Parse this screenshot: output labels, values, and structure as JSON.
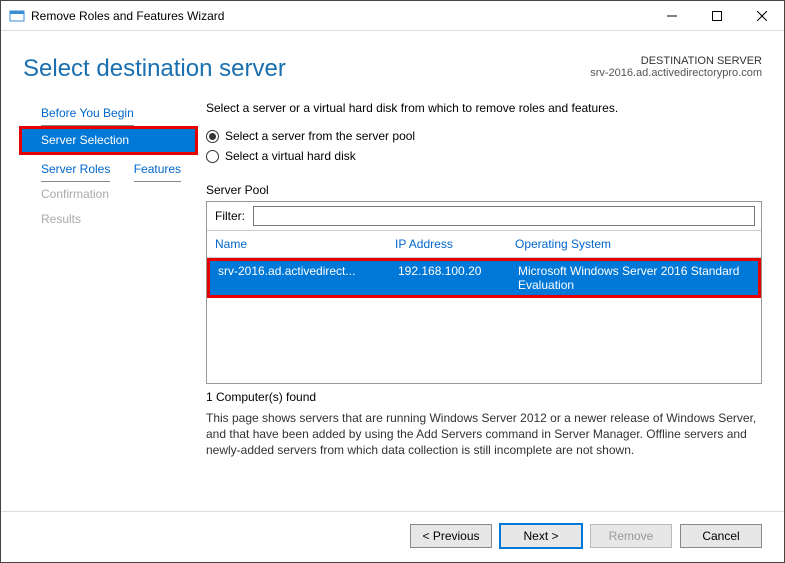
{
  "window": {
    "title": "Remove Roles and Features Wizard"
  },
  "header": {
    "page_title": "Select destination server",
    "dest_label": "DESTINATION SERVER",
    "dest_value": "srv-2016.ad.activedirectorypro.com"
  },
  "sidebar": {
    "items": [
      {
        "label": "Before You Begin",
        "state": "link"
      },
      {
        "label": "Server Selection",
        "state": "active"
      },
      {
        "label": "Server Roles",
        "state": "link"
      },
      {
        "label": "Features",
        "state": "link"
      },
      {
        "label": "Confirmation",
        "state": "disabled"
      },
      {
        "label": "Results",
        "state": "disabled"
      }
    ]
  },
  "main": {
    "instruction": "Select a server or a virtual hard disk from which to remove roles and features.",
    "radio1": "Select a server from the server pool",
    "radio2": "Select a virtual hard disk",
    "pool_label": "Server Pool",
    "filter_label": "Filter:",
    "filter_value": "",
    "columns": {
      "name": "Name",
      "ip": "IP Address",
      "os": "Operating System"
    },
    "rows": [
      {
        "name": "srv-2016.ad.activedirect...",
        "ip": "192.168.100.20",
        "os": "Microsoft Windows Server 2016 Standard Evaluation"
      }
    ],
    "count_label": "1 Computer(s) found",
    "note": "This page shows servers that are running Windows Server 2012 or a newer release of Windows Server, and that have been added by using the Add Servers command in Server Manager. Offline servers and newly-added servers from which data collection is still incomplete are not shown."
  },
  "footer": {
    "previous": "< Previous",
    "next": "Next >",
    "remove": "Remove",
    "cancel": "Cancel"
  }
}
